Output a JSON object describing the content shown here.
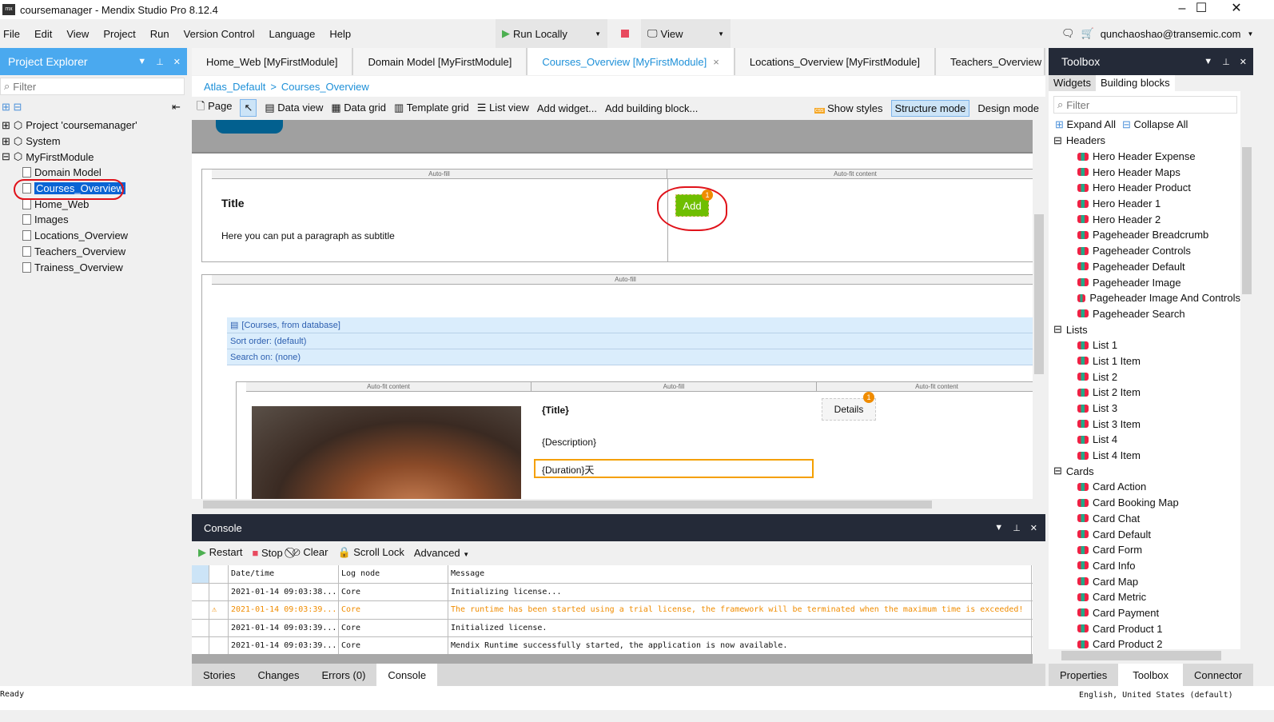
{
  "window": {
    "title": "coursemanager - Mendix Studio Pro 8.12.4"
  },
  "menu": [
    "File",
    "Edit",
    "View",
    "Project",
    "Run",
    "Version Control",
    "Language",
    "Help"
  ],
  "toolbar_top": {
    "run": "Run Locally",
    "view": "View",
    "user": "qunchaoshao@transemic.com"
  },
  "project_explorer": {
    "title": "Project Explorer",
    "filter_placeholder": "Filter",
    "tree": [
      {
        "label": "Project 'coursemanager'",
        "level": 0,
        "exp": "+"
      },
      {
        "label": "System",
        "level": 0,
        "exp": "+"
      },
      {
        "label": "MyFirstModule",
        "level": 0,
        "exp": "-"
      },
      {
        "label": "Domain Model",
        "level": 1
      },
      {
        "label": "Courses_Overview",
        "level": 1,
        "selected": true
      },
      {
        "label": "Home_Web",
        "level": 1
      },
      {
        "label": "Images",
        "level": 1
      },
      {
        "label": "Locations_Overview",
        "level": 1
      },
      {
        "label": "Teachers_Overview",
        "level": 1
      },
      {
        "label": "Trainess_Overview",
        "level": 1
      }
    ]
  },
  "tabs": [
    {
      "label": "Home_Web [MyFirstModule]"
    },
    {
      "label": "Domain Model [MyFirstModule]"
    },
    {
      "label": "Courses_Overview [MyFirstModule]",
      "active": true
    },
    {
      "label": "Locations_Overview [MyFirstModule]"
    },
    {
      "label": "Teachers_Overview [MyFirstModule]"
    }
  ],
  "breadcrumb": {
    "a": "Atlas_Default",
    "sep": ">",
    "b": "Courses_Overview"
  },
  "editor_toolbar": {
    "page": "Page",
    "data_view": "Data view",
    "data_grid": "Data grid",
    "template_grid": "Template grid",
    "list_view": "List view",
    "add_widget": "Add widget...",
    "add_block": "Add building block...",
    "show_styles": "Show styles",
    "structure": "Structure mode",
    "design": "Design mode"
  },
  "canvas": {
    "auto_fill": "Auto-fill",
    "auto_fit": "Auto-fit content",
    "title": "Title",
    "subtitle": "Here you can put a paragraph as subtitle",
    "add": "Add",
    "badge": "1",
    "ds": "[Courses, from database]",
    "sort": "Sort order: (default)",
    "search": "Search on: (none)",
    "t": "{Title}",
    "desc": "{Description}",
    "dur": "{Duration}天",
    "details": "Details"
  },
  "console": {
    "title": "Console",
    "restart": "Restart",
    "stop": "Stop",
    "clear": "Clear",
    "scroll_lock": "Scroll Lock",
    "advanced": "Advanced",
    "headers": [
      "Date/time",
      "Log node",
      "Message"
    ],
    "rows": [
      {
        "date": "2021-01-14 09:03:38...",
        "node": "Core",
        "msg": "Initializing license..."
      },
      {
        "date": "2021-01-14 09:03:39...",
        "node": "Core",
        "msg": "The runtime has been started using a trial license, the framework will be terminated when the maximum time is exceeded!",
        "warning": true
      },
      {
        "date": "2021-01-14 09:03:39...",
        "node": "Core",
        "msg": "Initialized license."
      },
      {
        "date": "2021-01-14 09:03:39...",
        "node": "Core",
        "msg": "Mendix Runtime successfully started, the application is now available."
      }
    ]
  },
  "bottom_tabs": [
    {
      "label": "Stories"
    },
    {
      "label": "Changes"
    },
    {
      "label": "Errors (0)"
    },
    {
      "label": "Console",
      "active": true
    }
  ],
  "toolbox": {
    "title": "Toolbox",
    "tab_widgets": "Widgets",
    "tab_blocks": "Building blocks",
    "filter_placeholder": "Filter",
    "expand_all": "Expand All",
    "collapse_all": "Collapse All",
    "groups": [
      {
        "name": "Headers",
        "items": [
          "Hero Header Expense",
          "Hero Header Maps",
          "Hero Header Product",
          "Hero Header 1",
          "Hero Header 2",
          "Pageheader Breadcrumb",
          "Pageheader Controls",
          "Pageheader Default",
          "Pageheader Image",
          "Pageheader Image And Controls",
          "Pageheader Search"
        ]
      },
      {
        "name": "Lists",
        "items": [
          "List 1",
          "List 1 Item",
          "List 2",
          "List 2 Item",
          "List 3",
          "List 3 Item",
          "List 4",
          "List 4 Item"
        ]
      },
      {
        "name": "Cards",
        "items": [
          "Card Action",
          "Card Booking Map",
          "Card Chat",
          "Card Default",
          "Card Form",
          "Card Info",
          "Card Map",
          "Card Metric",
          "Card Payment",
          "Card Product 1",
          "Card Product 2"
        ]
      }
    ]
  },
  "right_tabs": [
    {
      "label": "Properties"
    },
    {
      "label": "Toolbox",
      "active": true
    },
    {
      "label": "Connector"
    }
  ],
  "status": {
    "left": "Ready",
    "right": "English, United States (default)"
  },
  "colors": {
    "accent": "#4aa9ef",
    "panel_dark": "#242a38",
    "add_green": "#6fbe00",
    "warning": "#f08c00"
  }
}
